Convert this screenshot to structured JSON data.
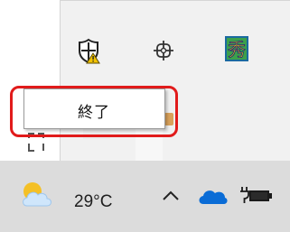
{
  "context_menu": {
    "items": [
      {
        "label": "終了"
      }
    ]
  },
  "flyout": {
    "icons": [
      {
        "name": "security-shield-warning-icon"
      },
      {
        "name": "app-knot-icon"
      },
      {
        "name": "kanji-app-icon",
        "glyph": "秀"
      }
    ]
  },
  "taskbar": {
    "weather": {
      "temperature": "29°C",
      "icon": "partly-cloudy-icon"
    },
    "tray": [
      {
        "name": "chevron-up-icon"
      },
      {
        "name": "onedrive-cloud-icon"
      },
      {
        "name": "battery-plug-icon"
      }
    ]
  },
  "colors": {
    "highlight": "#e11b1b",
    "flyout_bg": "#f1f1f1",
    "taskbar_bg": "#dcdcdc",
    "onedrive": "#0a6cd6"
  }
}
